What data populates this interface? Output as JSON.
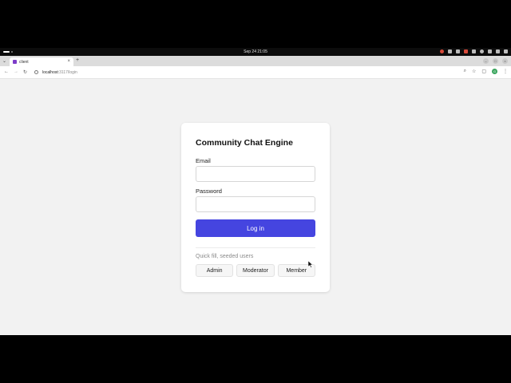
{
  "topbar": {
    "clock": "Sep 24  21:05"
  },
  "browser": {
    "tab_title": "client",
    "tab_close": "×",
    "new_tab": "+",
    "url_host": "localhost",
    "url_path": ":3117/login",
    "profile_initial": "G"
  },
  "card": {
    "title": "Community Chat Engine",
    "email_label": "Email",
    "email_value": "",
    "password_label": "Password",
    "password_value": "",
    "login_label": "Log in",
    "quick_fill_label": "Quick fill, seeded users",
    "quick_fill_buttons": [
      "Admin",
      "Moderator",
      "Member"
    ]
  },
  "colors": {
    "primary": "#4545e0",
    "page_bg": "#f2f2f2",
    "favicon": "#7d3cc9"
  },
  "icons": {
    "back": "arrow-left-icon",
    "forward": "arrow-right-icon",
    "reload": "reload-icon",
    "site_info": "site-info-icon",
    "zoom": "search-icon",
    "bookmark": "star-icon",
    "extensions": "extensions-icon",
    "menu": "kebab-menu-icon"
  }
}
